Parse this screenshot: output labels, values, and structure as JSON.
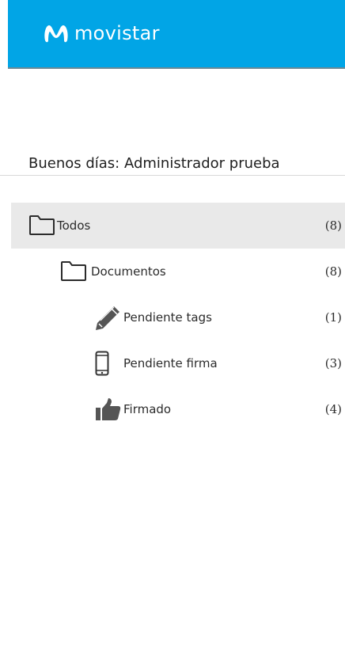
{
  "header": {
    "brand": "movistar",
    "logo_icon": "movistar-m-icon",
    "background_color": "#01a5e6"
  },
  "greeting": "Buenos días: Administrador prueba",
  "tree": [
    {
      "label": "Todos",
      "count": "(8)",
      "icon": "folder-icon",
      "level": 0,
      "selected": true
    },
    {
      "label": "Documentos",
      "count": "(8)",
      "icon": "folder-icon",
      "level": 1,
      "selected": false
    },
    {
      "label": "Pendiente tags",
      "count": "(1)",
      "icon": "pencil-icon",
      "level": 2,
      "selected": false
    },
    {
      "label": "Pendiente firma",
      "count": "(3)",
      "icon": "phone-icon",
      "level": 2,
      "selected": false
    },
    {
      "label": "Firmado",
      "count": "(4)",
      "icon": "thumbs-up-icon",
      "level": 2,
      "selected": false
    }
  ]
}
